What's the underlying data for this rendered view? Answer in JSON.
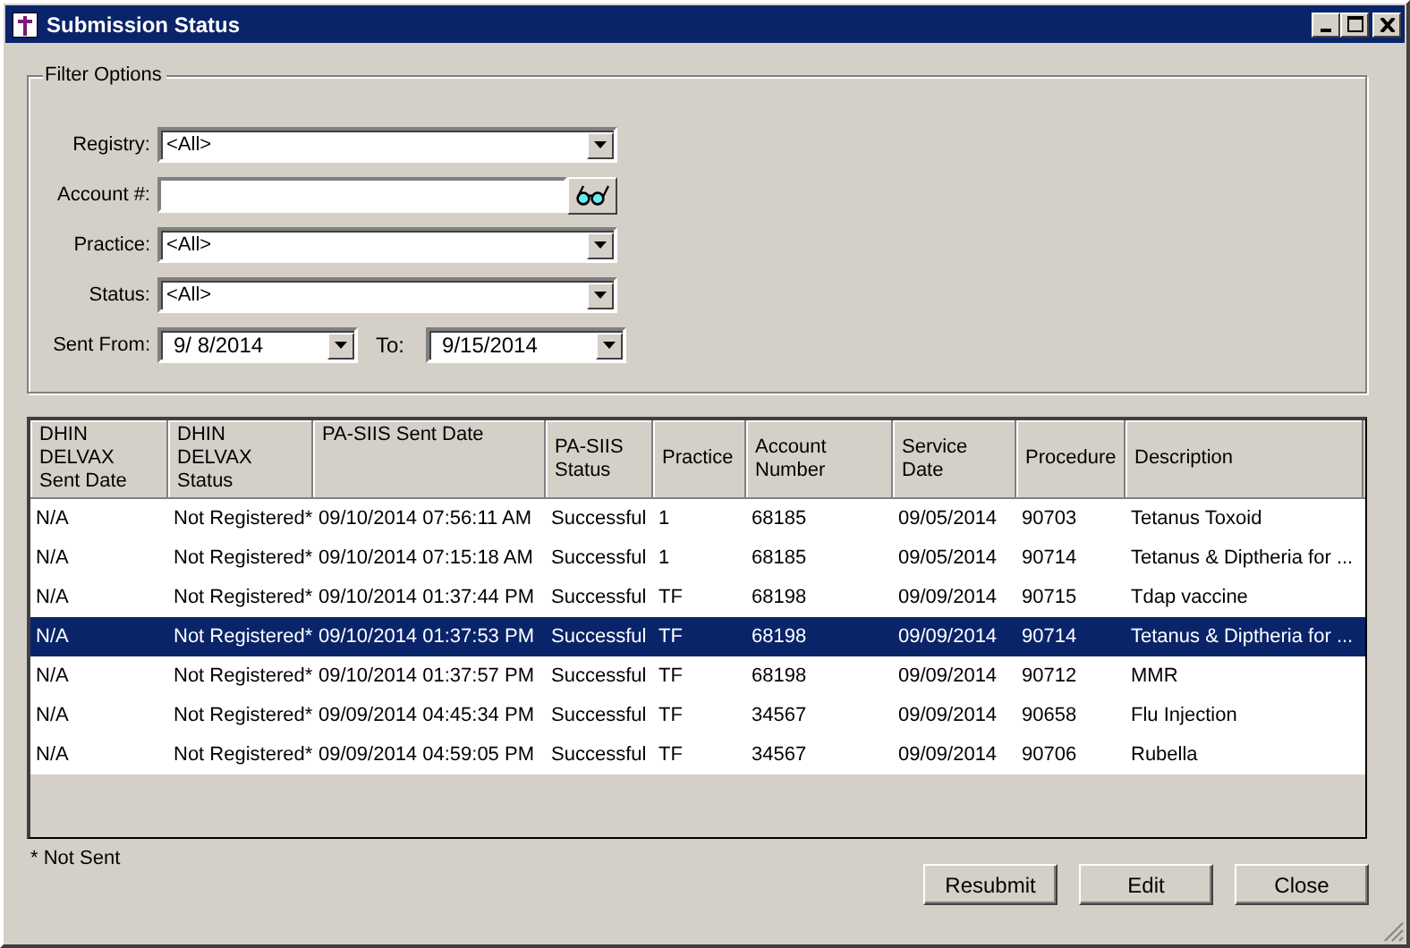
{
  "window": {
    "title": "Submission Status"
  },
  "filter": {
    "legend": "Filter Options",
    "registry": {
      "label": "Registry:",
      "value": "<All>"
    },
    "account": {
      "label": "Account #:"
    },
    "practice": {
      "label": "Practice:",
      "value": "<All>"
    },
    "status": {
      "label": "Status:",
      "value": "<All>"
    },
    "sent_from": {
      "label": "Sent From:",
      "value": "9/  8/2014"
    },
    "to": {
      "label": "To:",
      "value": "9/15/2014"
    }
  },
  "table": {
    "columns": [
      "DHIN DELVAX Sent Date",
      "DHIN DELVAX Status",
      "PA-SIIS Sent Date",
      "PA-SIIS Status",
      "Practice",
      "Account Number",
      "Service Date",
      "Procedure",
      "Description"
    ],
    "rows": [
      {
        "selected": false,
        "cells": [
          "N/A",
          "Not Registered*",
          "09/10/2014 07:56:11 AM",
          "Successful",
          "1",
          "68185",
          "09/05/2014",
          "90703",
          "Tetanus Toxoid"
        ]
      },
      {
        "selected": false,
        "cells": [
          "N/A",
          "Not Registered*",
          "09/10/2014 07:15:18 AM",
          "Successful",
          "1",
          "68185",
          "09/05/2014",
          "90714",
          "Tetanus & Diptheria for ..."
        ]
      },
      {
        "selected": false,
        "cells": [
          "N/A",
          "Not Registered*",
          "09/10/2014 01:37:44 PM",
          "Successful",
          "TF",
          "68198",
          "09/09/2014",
          "90715",
          "Tdap vaccine"
        ]
      },
      {
        "selected": true,
        "cells": [
          "N/A",
          "Not Registered*",
          "09/10/2014 01:37:53 PM",
          "Successful",
          "TF",
          "68198",
          "09/09/2014",
          "90714",
          "Tetanus & Diptheria for ..."
        ]
      },
      {
        "selected": false,
        "cells": [
          "N/A",
          "Not Registered*",
          "09/10/2014 01:37:57 PM",
          "Successful",
          "TF",
          "68198",
          "09/09/2014",
          "90712",
          "MMR"
        ]
      },
      {
        "selected": false,
        "cells": [
          "N/A",
          "Not Registered*",
          "09/09/2014 04:45:34 PM",
          "Successful",
          "TF",
          "34567",
          "09/09/2014",
          "90658",
          "Flu Injection"
        ]
      },
      {
        "selected": false,
        "cells": [
          "N/A",
          "Not Registered*",
          "09/09/2014 04:59:05 PM",
          "Successful",
          "TF",
          "34567",
          "09/09/2014",
          "90706",
          "Rubella"
        ]
      }
    ]
  },
  "footnote": "* Not Sent",
  "buttons": [
    "Resubmit",
    "Edit",
    "Close"
  ]
}
